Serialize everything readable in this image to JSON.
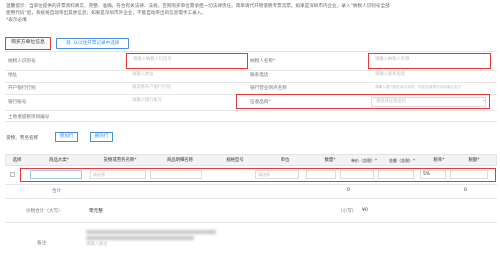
{
  "notice": {
    "line1": "温馨提示：当单位提供的开票资料真实、完整、准确，符合有关法律、法规，否则购买单位需承担一切法律责任。简单请代开增值税专票流票。如果是深圳市内企业，录入“纳税人识别号全部",
    "line2": "使用代码”后，系统将自动带出其余信息；如果是深圳市外企业，不能自动带出的信息需手工录入。",
    "line3_mark": "*",
    "line3_text": "表示必填"
  },
  "buyer_tab": "购买方单位信息",
  "import_button": "从以往开票记录中选择",
  "form": {
    "taxpayer_id_label": "纳税人识别号",
    "taxpayer_id_placeholder": "请输入纳税人识别号",
    "taxpayer_name_label": "纳税人名称*",
    "taxpayer_name_placeholder": "请输入纳税人名称",
    "address_label": "地址",
    "address_placeholder": "请输入地址",
    "phone_label": "联系电话",
    "phone_placeholder": "请输入联系电话",
    "bank_label": "开户银行行别",
    "bank_placeholder": "请选择开户银行行别",
    "bank_account_label": "银行营业网点名称",
    "bank_account_placeholder": "请输入银行营业网点名称，例如招商银行深圳南山支行",
    "branch_label": "银行账号",
    "branch_placeholder": "请输入银行账号",
    "goods_type_label": "征收品目*",
    "goods_type_placeholder": "请选择征收品目",
    "land_label": "土地增值税项目编号"
  },
  "goods": {
    "section_label": "货物、劳务名称",
    "add_row": "增加行",
    "delete_row": "删除行",
    "headers": [
      "选择",
      "商品大类*",
      "货物或劳务名称*",
      "商品明细名称",
      "规格型号",
      "单位",
      "数量*",
      "单价（含税）*",
      "金额（含税）*",
      "税率*",
      "税额*"
    ],
    "row": {
      "name_placeholder": "请选择",
      "item_placeholder": "请选择",
      "tax_rate": "5%"
    },
    "total_label": "合计",
    "total_amount": "0",
    "total_tax": "0",
    "capital_label": "价税合计（大写）",
    "capital_value": "零元整",
    "lower_label": "（小写）",
    "lower_value": "¥0",
    "remark_label": "备注",
    "remark_placeholder": "请输入备注"
  }
}
